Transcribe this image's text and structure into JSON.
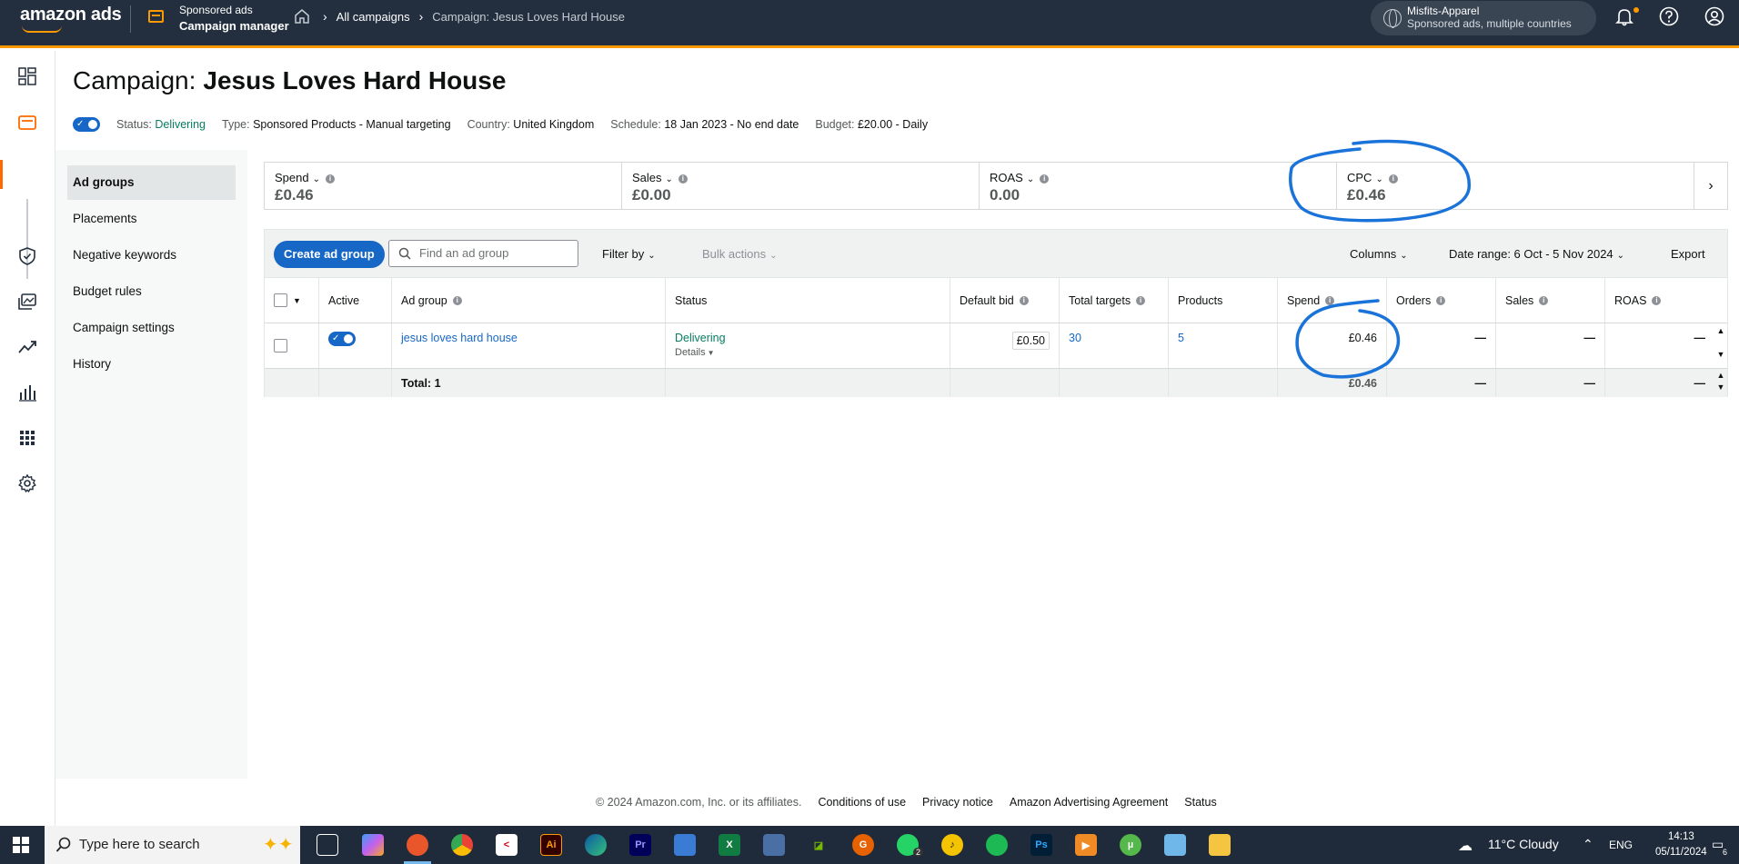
{
  "topbar": {
    "logo": "amazon ads",
    "product_line1": "Sponsored ads",
    "product_line2": "Campaign manager",
    "breadcrumb": [
      "All campaigns",
      "Campaign: Jesus Loves Hard House"
    ],
    "account_name": "Misfits-Apparel",
    "account_scope": "Sponsored ads, multiple countries"
  },
  "page": {
    "title_prefix": "Campaign:",
    "title_name": "Jesus Loves Hard House",
    "status_label": "Status:",
    "status_value": "Delivering",
    "type_label": "Type:",
    "type_value": "Sponsored Products - Manual targeting",
    "country_label": "Country:",
    "country_value": "United Kingdom",
    "schedule_label": "Schedule:",
    "schedule_value": "18 Jan 2023 - No end date",
    "budget_label": "Budget:",
    "budget_value": "£20.00 - Daily"
  },
  "subnav": [
    "Ad groups",
    "Placements",
    "Negative keywords",
    "Budget rules",
    "Campaign settings",
    "History"
  ],
  "metrics": [
    {
      "name": "Spend",
      "value": "£0.46"
    },
    {
      "name": "Sales",
      "value": "£0.00"
    },
    {
      "name": "ROAS",
      "value": "0.00"
    },
    {
      "name": "CPC",
      "value": "£0.46"
    }
  ],
  "toolbar": {
    "create_label": "Create ad group",
    "search_placeholder": "Find an ad group",
    "filter_label": "Filter by",
    "bulk_label": "Bulk actions",
    "columns_label": "Columns",
    "date_range": "Date range: 6 Oct - 5 Nov 2024",
    "export_label": "Export"
  },
  "table": {
    "headers": [
      "Active",
      "Ad group",
      "Status",
      "Default bid",
      "Total targets",
      "Products",
      "Spend",
      "Orders",
      "Sales",
      "ROAS"
    ],
    "row": {
      "ad_group": "jesus loves hard house",
      "status": "Delivering",
      "details": "Details",
      "default_bid": "£0.50",
      "total_targets": "30",
      "products": "5",
      "spend": "£0.46",
      "orders": "—",
      "sales": "—",
      "roas": "—"
    },
    "totals": {
      "label": "Total: 1",
      "spend": "£0.46",
      "orders": "—",
      "sales": "—",
      "roas": "—"
    }
  },
  "footer": {
    "copyright": "© 2024 Amazon.com, Inc. or its affiliates.",
    "links": [
      "Conditions of use",
      "Privacy notice",
      "Amazon Advertising Agreement",
      "Status"
    ]
  },
  "taskbar": {
    "search_placeholder": "Type here to search",
    "weather": "11°C  Cloudy",
    "language": "ENG",
    "time": "14:13",
    "date": "05/11/2024",
    "whatsapp_badge": "2",
    "notification_count": "6"
  },
  "colors": {
    "topbar": "#232f3e",
    "accent_orange": "#ff9900",
    "primary_blue": "#1667c6",
    "delivering_green": "#067d62",
    "annotation_blue": "#1a73d9"
  }
}
